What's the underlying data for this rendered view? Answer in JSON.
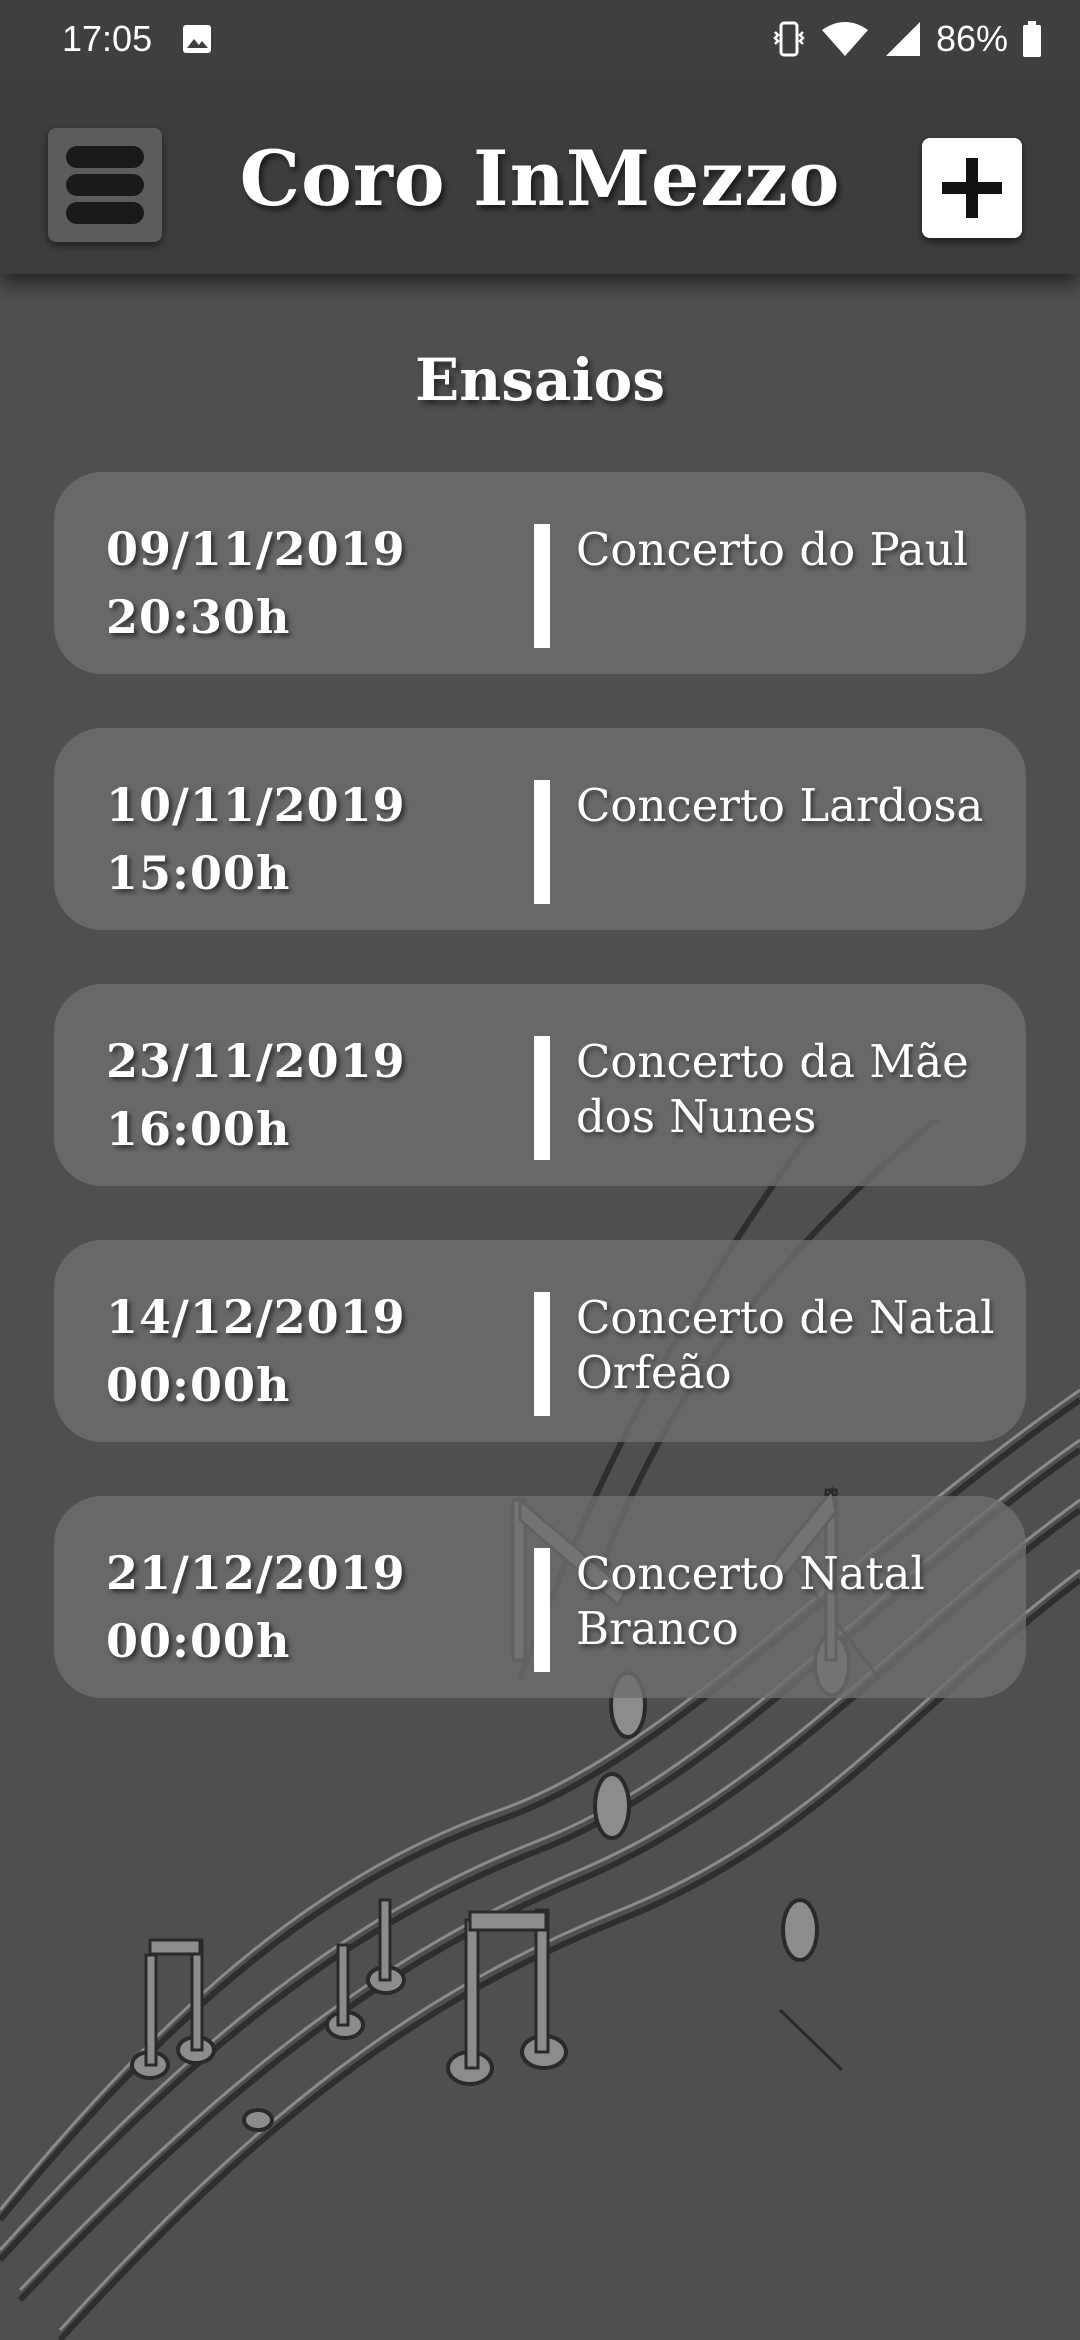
{
  "status_bar": {
    "time": "17:05",
    "battery": "86%",
    "icons": [
      "image-icon",
      "vibrate-icon",
      "wifi-icon",
      "signal-icon",
      "battery-icon"
    ]
  },
  "app_bar": {
    "title": "Coro InMezzo",
    "menu_icon": "menu-icon",
    "add_icon": "plus-icon"
  },
  "page": {
    "section_title": "Ensaios"
  },
  "events": [
    {
      "date": "09/11/2019",
      "time": "20:30h",
      "name": "Concerto do Paul"
    },
    {
      "date": "10/11/2019",
      "time": "15:00h",
      "name": "Concerto Lardosa"
    },
    {
      "date": "23/11/2019",
      "time": "16:00h",
      "name": "Concerto da Mãe dos Nunes"
    },
    {
      "date": "14/12/2019",
      "time": "00:00h",
      "name": "Concerto de Natal Orfeão"
    },
    {
      "date": "21/12/2019",
      "time": "00:00h",
      "name": "Concerto Natal Branco"
    }
  ],
  "colors": {
    "background": "#4f4f4f",
    "app_bar": "#3d3d3d",
    "card": "#6e6e6e",
    "text": "#ffffff"
  }
}
